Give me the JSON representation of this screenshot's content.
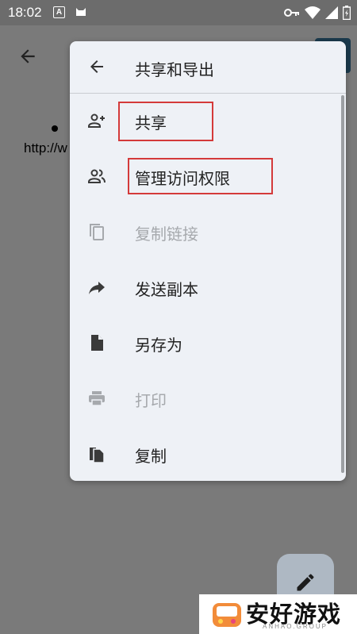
{
  "status_bar": {
    "time": "18:02",
    "a_badge": "A"
  },
  "background": {
    "link_text": "http://w"
  },
  "menu": {
    "title": "共享和导出",
    "items": [
      {
        "label": "共享",
        "icon": "person-add-icon",
        "disabled": false
      },
      {
        "label": "管理访问权限",
        "icon": "people-icon",
        "disabled": false
      },
      {
        "label": "复制链接",
        "icon": "copy-icon",
        "disabled": true
      },
      {
        "label": "发送副本",
        "icon": "forward-icon",
        "disabled": false
      },
      {
        "label": "另存为",
        "icon": "file-icon",
        "disabled": false
      },
      {
        "label": "打印",
        "icon": "print-icon",
        "disabled": true
      },
      {
        "label": "复制",
        "icon": "file-copy-icon",
        "disabled": false
      }
    ]
  },
  "watermark": {
    "name": "安好游戏",
    "url": "ANHAO.GROUP"
  },
  "colors": {
    "highlight": "#d43a3a",
    "menu_bg": "#eef1f6",
    "disabled_text": "#a6a9ad",
    "scrim": "#7a7a7a"
  }
}
